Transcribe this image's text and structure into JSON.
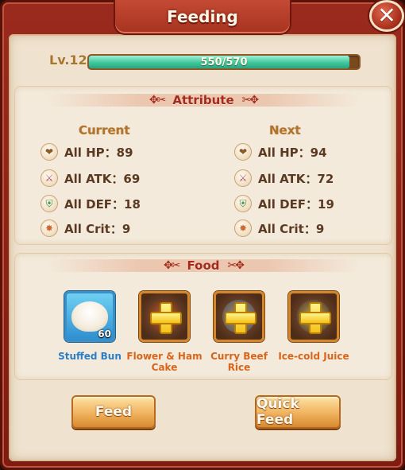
{
  "window": {
    "title": "Feeding",
    "close_label": "✕"
  },
  "level": {
    "label": "Lv.12",
    "xp_text": "550/570",
    "xp_fraction": 0.965
  },
  "attribute": {
    "header": "Attribute",
    "current": {
      "title": "Current",
      "stats": [
        {
          "icon": "heart-icon",
          "glyph": "❤",
          "text": "All HP：89"
        },
        {
          "icon": "sword-icon",
          "glyph": "⚔",
          "text": "All ATK：69"
        },
        {
          "icon": "shield-icon",
          "glyph": "⛨",
          "text": "All DEF：18"
        },
        {
          "icon": "crit-icon",
          "glyph": "✸",
          "text": "All Crit：9"
        }
      ]
    },
    "next": {
      "title": "Next",
      "stats": [
        {
          "icon": "heart-icon",
          "glyph": "❤",
          "text": "All HP：94"
        },
        {
          "icon": "sword-icon",
          "glyph": "⚔",
          "text": "All ATK：72"
        },
        {
          "icon": "shield-icon",
          "glyph": "⛨",
          "text": "All DEF：19"
        },
        {
          "icon": "crit-icon",
          "glyph": "✸",
          "text": "All Crit：9"
        }
      ]
    }
  },
  "food": {
    "header": "Food",
    "items": [
      {
        "name": "Stuffed Bun",
        "count": "60",
        "filled": true,
        "color": "#2a7fc9"
      },
      {
        "name": "Flower & Ham Cake",
        "filled": false,
        "color": "#d9651b"
      },
      {
        "name": "Curry Beef Rice",
        "filled": false,
        "color": "#d9651b"
      },
      {
        "name": "Ice-cold Juice",
        "filled": false,
        "color": "#d9651b"
      }
    ]
  },
  "actions": {
    "feed_label": "Feed",
    "quick_feed_label": "Quick Feed"
  },
  "colors": {
    "accent": "#a32a1c",
    "xp_fill": "#3fc79c",
    "frame": "#9a2a1d"
  }
}
